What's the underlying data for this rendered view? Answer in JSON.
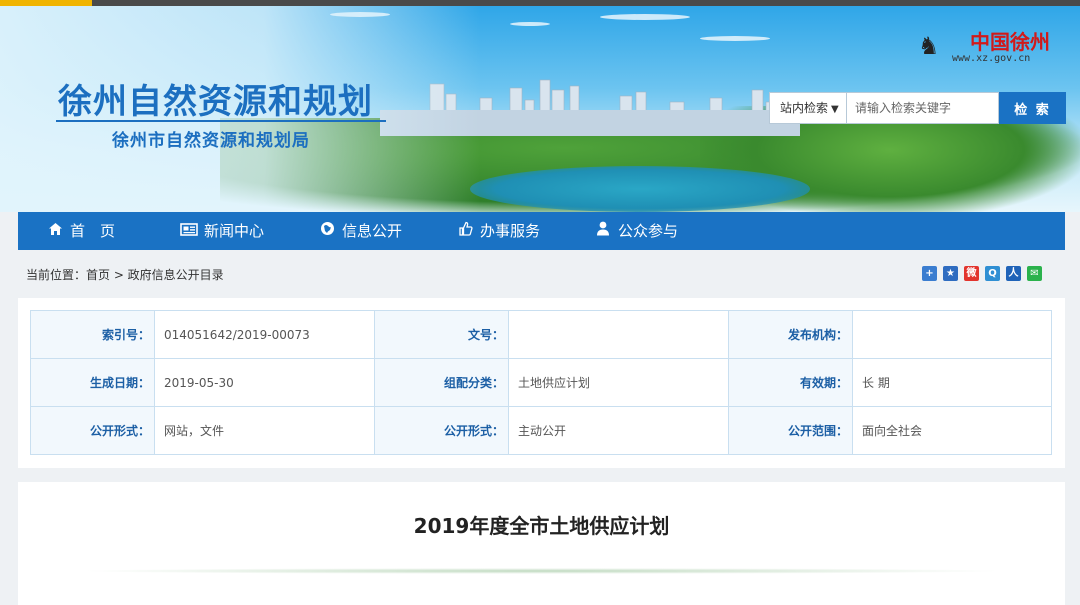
{
  "header": {
    "site_title": "徐州自然资源和规划",
    "site_subtitle": "徐州市自然资源和规划局",
    "logo_text": "中国徐州",
    "logo_url": "www.xz.gov.cn"
  },
  "search": {
    "scope_label": "站内检索",
    "placeholder": "请输入检索关键字",
    "button_label": "检 索"
  },
  "nav": {
    "items": [
      {
        "label": "首　页",
        "icon": "home-icon"
      },
      {
        "label": "新闻中心",
        "icon": "newspaper-icon"
      },
      {
        "label": "信息公开",
        "icon": "globe-icon"
      },
      {
        "label": "办事服务",
        "icon": "thumbs-up-icon"
      },
      {
        "label": "公众参与",
        "icon": "user-icon"
      }
    ]
  },
  "breadcrumb": "当前位置：首页 > 政府信息公开目录",
  "share_icons": [
    "share-more-icon",
    "share-qzone-icon",
    "share-weibo-icon",
    "share-tencent-icon",
    "share-renren-icon",
    "share-wechat-icon"
  ],
  "metadata": {
    "rows": [
      [
        {
          "key": "索引号：",
          "value": "014051642/2019-00073"
        },
        {
          "key": "文号：",
          "value": ""
        },
        {
          "key": "发布机构：",
          "value": ""
        }
      ],
      [
        {
          "key": "生成日期：",
          "value": "2019-05-30"
        },
        {
          "key": "组配分类：",
          "value": "土地供应计划"
        },
        {
          "key": "有效期：",
          "value": "长 期"
        }
      ],
      [
        {
          "key": "公开形式：",
          "value": "网站，文件"
        },
        {
          "key": "公开形式：",
          "value": "主动公开"
        },
        {
          "key": "公开范围：",
          "value": "面向全社会"
        }
      ]
    ]
  },
  "document": {
    "title": "2019年度全市土地供应计划"
  },
  "colors": {
    "primary": "#1a72c4",
    "title_blue": "#1c6fc0",
    "page_bg": "#eef1f4",
    "top_accent": "#f0b400"
  }
}
